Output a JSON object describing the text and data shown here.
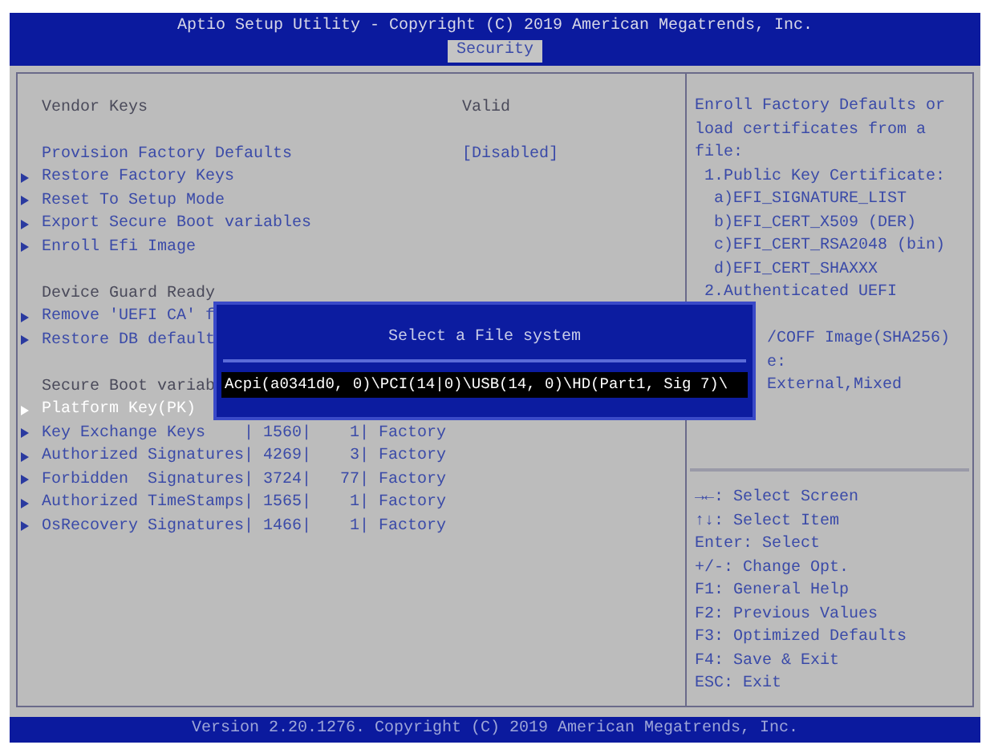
{
  "header": {
    "title": "Aptio Setup Utility - Copyright (C) 2019 American Megatrends, Inc.",
    "tabs": [
      {
        "label": "Security",
        "selected": true
      }
    ]
  },
  "menu": {
    "groups": [
      [
        {
          "kind": "info",
          "label": "Vendor Keys",
          "value": "Valid"
        },
        {
          "kind": "blank"
        },
        {
          "kind": "setting",
          "label": "Provision Factory Defaults",
          "value": "[Disabled]",
          "selected": false
        },
        {
          "kind": "submenu",
          "label": "Restore Factory Keys",
          "selected": false
        },
        {
          "kind": "submenu",
          "label": "Reset To Setup Mode",
          "selected": false
        },
        {
          "kind": "submenu",
          "label": "Export Secure Boot variables",
          "selected": false
        },
        {
          "kind": "submenu",
          "label": "Enroll Efi Image",
          "selected": false
        }
      ],
      [
        {
          "kind": "info",
          "label": "Device Guard Ready"
        },
        {
          "kind": "submenu",
          "label": "Remove 'UEFI CA' f",
          "selected": false
        },
        {
          "kind": "submenu",
          "label": "Restore DB default",
          "selected": false
        }
      ],
      [
        {
          "kind": "info",
          "label": "Secure Boot variab"
        },
        {
          "kind": "submenu",
          "label": "Platform Key(PK)",
          "selected": true
        },
        {
          "kind": "submenu",
          "label": "Key Exchange Keys    | 1560|    1| Factory",
          "selected": false
        },
        {
          "kind": "submenu",
          "label": "Authorized Signatures| 4269|    3| Factory",
          "selected": false
        },
        {
          "kind": "submenu",
          "label": "Forbidden  Signatures| 3724|   77| Factory",
          "selected": false
        },
        {
          "kind": "submenu",
          "label": "Authorized TimeStamps| 1565|    1| Factory",
          "selected": false
        },
        {
          "kind": "submenu",
          "label": "OsRecovery Signatures| 1466|    1| Factory",
          "selected": false
        }
      ]
    ]
  },
  "help": {
    "lines": [
      {
        "kind": "full",
        "text": "Enroll Factory Defaults or"
      },
      {
        "kind": "full",
        "text": "load certificates from a"
      },
      {
        "kind": "full",
        "text": "file:"
      },
      {
        "kind": "full",
        "text": " 1.Public Key Certificate:"
      },
      {
        "kind": "full",
        "text": "  a)EFI_SIGNATURE_LIST"
      },
      {
        "kind": "full",
        "text": "  b)EFI_CERT_X509 (DER)"
      },
      {
        "kind": "full",
        "text": "  c)EFI_CERT_RSA2048 (bin)"
      },
      {
        "kind": "full",
        "text": "  d)EFI_CERT_SHAXXX"
      },
      {
        "kind": "full",
        "text": " 2.Authenticated UEFI"
      },
      {
        "kind": "hidden"
      },
      {
        "kind": "partial",
        "text": "/COFF Image(SHA256)"
      },
      {
        "kind": "partial",
        "text": "e:"
      },
      {
        "kind": "partial",
        "text": "External,Mixed"
      }
    ],
    "keys": [
      "→←: Select Screen",
      "↑↓: Select Item",
      "Enter: Select",
      "+/-: Change Opt.",
      "F1: General Help",
      "F2: Previous Values",
      "F3: Optimized Defaults",
      "F4: Save & Exit",
      "ESC: Exit"
    ]
  },
  "dialog": {
    "title": "Select a File system",
    "options": [
      {
        "label": "Acpi(a0341d0, 0)\\PCI(14|0)\\USB(14, 0)\\HD(Part1, Sig 7)\\",
        "selected": true
      }
    ]
  },
  "footer": "Version 2.20.1276. Copyright (C) 2019 American Megatrends, Inc."
}
